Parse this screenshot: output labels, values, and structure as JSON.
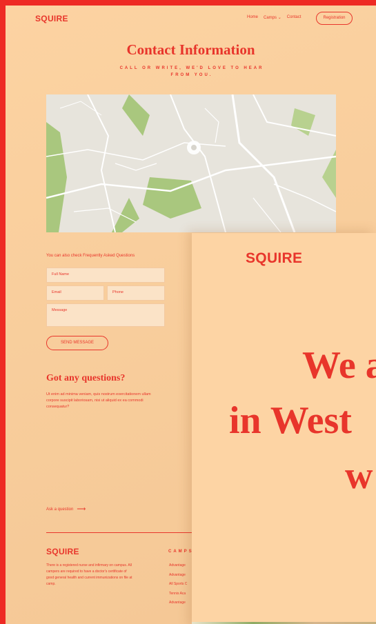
{
  "nav": {
    "logo": "SQUIRE",
    "links": [
      "Home",
      "Camps",
      "Contact"
    ],
    "camps_chevron": "⌄",
    "register": "Registration"
  },
  "header": {
    "title": "Contact Information",
    "subtitle": "CALL OR WRITE, WE'D LOVE TO HEAR FROM YOU."
  },
  "form": {
    "faq_note": "You can also check Frequently Asked Questions",
    "full_name_placeholder": "Full Name",
    "email_placeholder": "Email",
    "phone_placeholder": "Phone",
    "message_placeholder": "Message",
    "send_label": "SEND MESSAGE"
  },
  "questions": {
    "title": "Got any questions?",
    "body": "Ut enim ad minima veniam, quis nostrum exercitationem ullam corpore suscipit laboriosam, nisi ut aliquid ex ea commodi consequatur?",
    "ask_label": "Ask a question",
    "arrow": "⟶"
  },
  "footer": {
    "logo": "SQUIRE",
    "text": "There is a registered nurse and infirmary on campus. All campers are required to have a doctor's certificate of good general health and current immunizations on file at camp.",
    "camps_heading": "CAMPS",
    "camps": [
      "Advantage",
      "Advantage",
      "All Sports C",
      "Tennis Aca",
      "Advantage"
    ]
  },
  "overlay": {
    "logo": "SQUIRE",
    "hero_line1": "We a",
    "hero_line2": "in West",
    "hero_line3": "w"
  },
  "colors": {
    "accent": "#e8352b",
    "background": "#fcd3a2",
    "border": "#ee2a24"
  },
  "icons": [
    "map-pin-icon",
    "arrow-right-icon",
    "chevron-down-icon"
  ]
}
